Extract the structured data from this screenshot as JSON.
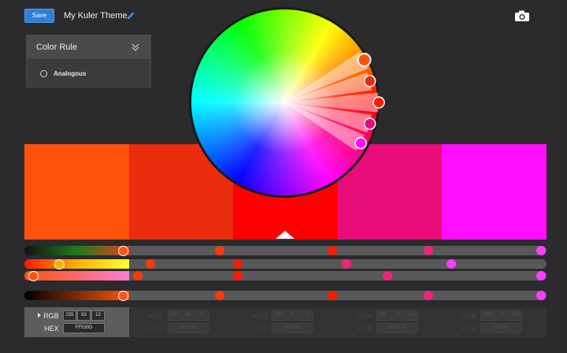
{
  "toolbar": {
    "save_label": "Save",
    "theme_name": "My Kuler Theme"
  },
  "color_rule": {
    "title": "Color Rule",
    "selected_option": "Analogous"
  },
  "theme": {
    "selected_index": 2,
    "swatches": [
      {
        "hex": "#FF530D",
        "rgb": [
          "255",
          "83",
          "13"
        ],
        "hex_label": "FF530D"
      },
      {
        "hex": "#E82C0C",
        "rgb": [
          "232",
          "44",
          "12"
        ],
        "hex_label": "E82C0C"
      },
      {
        "hex": "#FF0000",
        "rgb": [
          "255",
          "0",
          "0"
        ],
        "hex_label": "FF0000"
      },
      {
        "hex": "#E80C7A",
        "rgb": [
          "232",
          "12",
          "122"
        ],
        "hex_label": "E80C7A"
      },
      {
        "hex": "#FF0DFF",
        "rgb": [
          "255",
          "13",
          "255"
        ],
        "hex_label": "FF0DFF"
      }
    ]
  },
  "labels": {
    "rgb": "RGB",
    "hex": "HEX"
  },
  "colors": {
    "accent": "#2f7fd9",
    "background": "#2b2b2d"
  }
}
